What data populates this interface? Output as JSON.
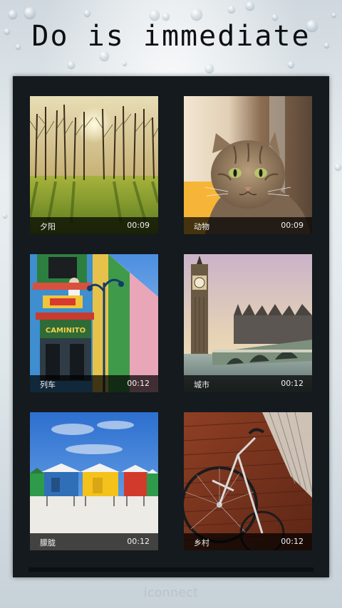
{
  "header": {
    "title": "Do is immediate"
  },
  "gallery": {
    "items": [
      {
        "label": "夕阳",
        "duration": "00:09",
        "thumb_icon": "sunset-forest-photo"
      },
      {
        "label": "动物",
        "duration": "00:09",
        "thumb_icon": "cat-photo"
      },
      {
        "label": "列车",
        "duration": "00:12",
        "thumb_icon": "colorful-street-photo"
      },
      {
        "label": "城市",
        "duration": "00:12",
        "thumb_icon": "big-ben-city-photo"
      },
      {
        "label": "朦胧",
        "duration": "00:12",
        "thumb_icon": "beach-huts-photo"
      },
      {
        "label": "乡村",
        "duration": "00:12",
        "thumb_icon": "bicycle-wall-photo"
      }
    ]
  },
  "footer": {
    "brand": "iconnect"
  },
  "colors": {
    "panel": "#141a1d",
    "caption_bar": "#000000",
    "title_text": "#0d0f12"
  }
}
